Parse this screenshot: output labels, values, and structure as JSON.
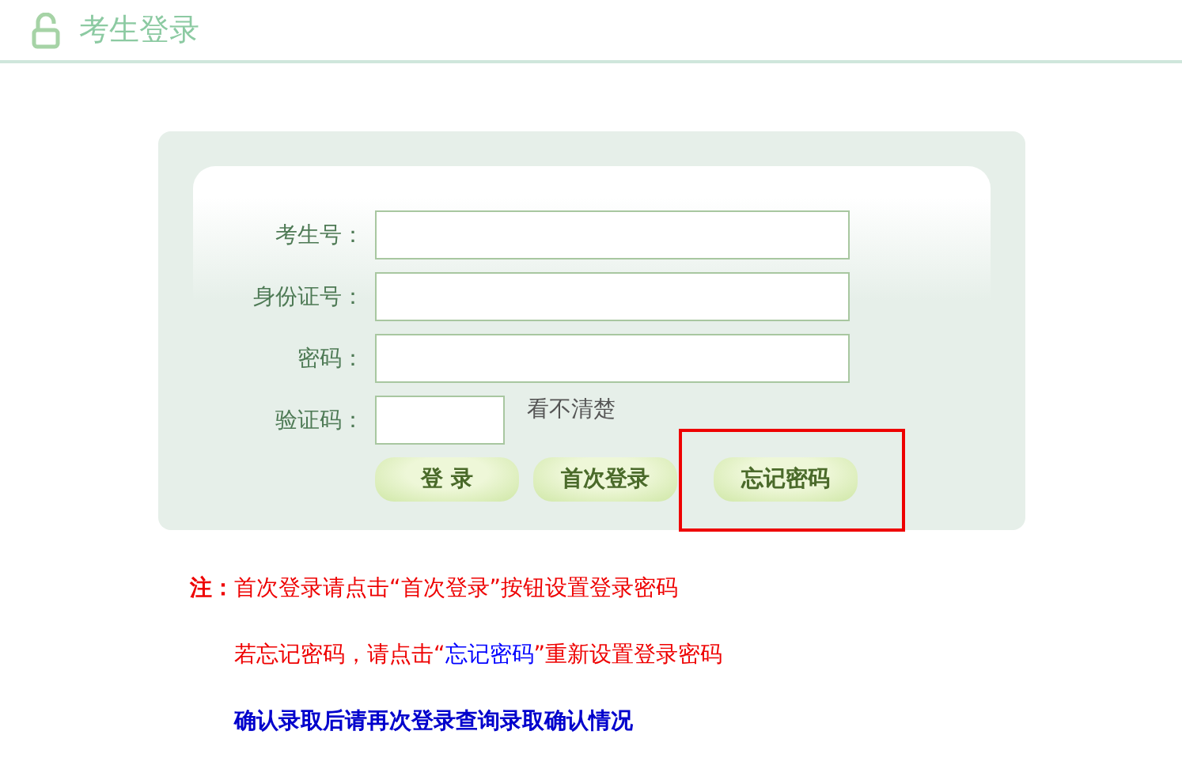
{
  "header": {
    "title": "考生登录"
  },
  "form": {
    "fields": [
      {
        "label": "考生号：",
        "kind": "text"
      },
      {
        "label": "身份证号：",
        "kind": "text"
      },
      {
        "label": "密码：",
        "kind": "text"
      },
      {
        "label": "验证码：",
        "kind": "captcha",
        "hint": "看不清楚"
      }
    ],
    "buttons": [
      {
        "label": "登 录",
        "highlighted": false
      },
      {
        "label": "首次登录",
        "highlighted": false
      },
      {
        "label": "忘记密码",
        "highlighted": true
      }
    ]
  },
  "notes": [
    {
      "indent": false,
      "parts": [
        {
          "kind": "label",
          "text": "注："
        },
        {
          "kind": "plain",
          "text": "首次登录请点击“首次登录”按钮设置登录密码"
        }
      ]
    },
    {
      "indent": true,
      "parts": [
        {
          "kind": "plain",
          "text": "若忘记密码，请点击“"
        },
        {
          "kind": "link",
          "text": "忘记密码"
        },
        {
          "kind": "plain",
          "text": "”重新设置登录密码"
        }
      ]
    },
    {
      "indent": true,
      "parts": [
        {
          "kind": "strong",
          "text": "确认录取后请再次登录查询录取确认情况"
        }
      ]
    }
  ]
}
